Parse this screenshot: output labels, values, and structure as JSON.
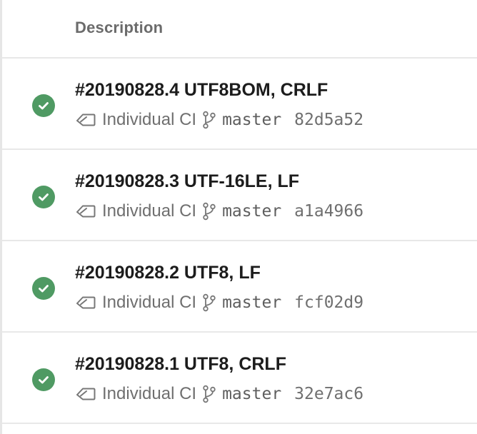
{
  "header": {
    "description_label": "Description"
  },
  "colors": {
    "success": "#4f9a63",
    "divider": "#e8e8e8",
    "title_text": "#1c1c1c",
    "meta_text": "#6f6f6f"
  },
  "icons": {
    "status": "check-circle-icon",
    "pipeline": "tag-icon",
    "branch": "git-branch-icon"
  },
  "runs": [
    {
      "title": "#20190828.4 UTF8BOM, CRLF",
      "pipeline": "Individual CI",
      "branch": "master",
      "commit": "82d5a52",
      "status": "succeeded"
    },
    {
      "title": "#20190828.3 UTF-16LE, LF",
      "pipeline": "Individual CI",
      "branch": "master",
      "commit": "a1a4966",
      "status": "succeeded"
    },
    {
      "title": "#20190828.2 UTF8, LF",
      "pipeline": "Individual CI",
      "branch": "master",
      "commit": "fcf02d9",
      "status": "succeeded"
    },
    {
      "title": "#20190828.1 UTF8, CRLF",
      "pipeline": "Individual CI",
      "branch": "master",
      "commit": "32e7ac6",
      "status": "succeeded"
    }
  ]
}
